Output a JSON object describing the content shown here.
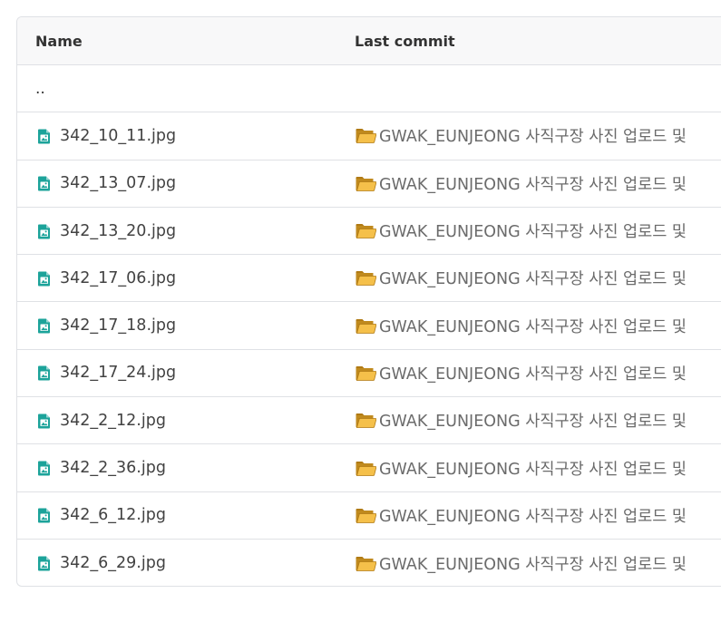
{
  "header": {
    "name_label": "Name",
    "commit_label": "Last commit"
  },
  "parent": {
    "label": ".."
  },
  "files": [
    {
      "name": "342_10_11.jpg",
      "commit": "GWAK_EUNJEONG 사직구장 사진 업로드 및"
    },
    {
      "name": "342_13_07.jpg",
      "commit": "GWAK_EUNJEONG 사직구장 사진 업로드 및"
    },
    {
      "name": "342_13_20.jpg",
      "commit": "GWAK_EUNJEONG 사직구장 사진 업로드 및"
    },
    {
      "name": "342_17_06.jpg",
      "commit": "GWAK_EUNJEONG 사직구장 사진 업로드 및"
    },
    {
      "name": "342_17_18.jpg",
      "commit": "GWAK_EUNJEONG 사직구장 사진 업로드 및"
    },
    {
      "name": "342_17_24.jpg",
      "commit": "GWAK_EUNJEONG 사직구장 사진 업로드 및"
    },
    {
      "name": "342_2_12.jpg",
      "commit": "GWAK_EUNJEONG 사직구장 사진 업로드 및"
    },
    {
      "name": "342_2_36.jpg",
      "commit": "GWAK_EUNJEONG 사직구장 사진 업로드 및"
    },
    {
      "name": "342_6_12.jpg",
      "commit": "GWAK_EUNJEONG 사직구장 사진 업로드 및"
    },
    {
      "name": "342_6_29.jpg",
      "commit": "GWAK_EUNJEONG 사직구장 사진 업로드 및"
    }
  ],
  "icons": {
    "file": "image-file-icon",
    "commit_prefix": "open-folder-icon"
  },
  "colors": {
    "file_icon": "#1ca39a",
    "folder_icon": "#f5c04a",
    "border": "#dfe1e5",
    "header_bg": "#f8f8f9"
  }
}
